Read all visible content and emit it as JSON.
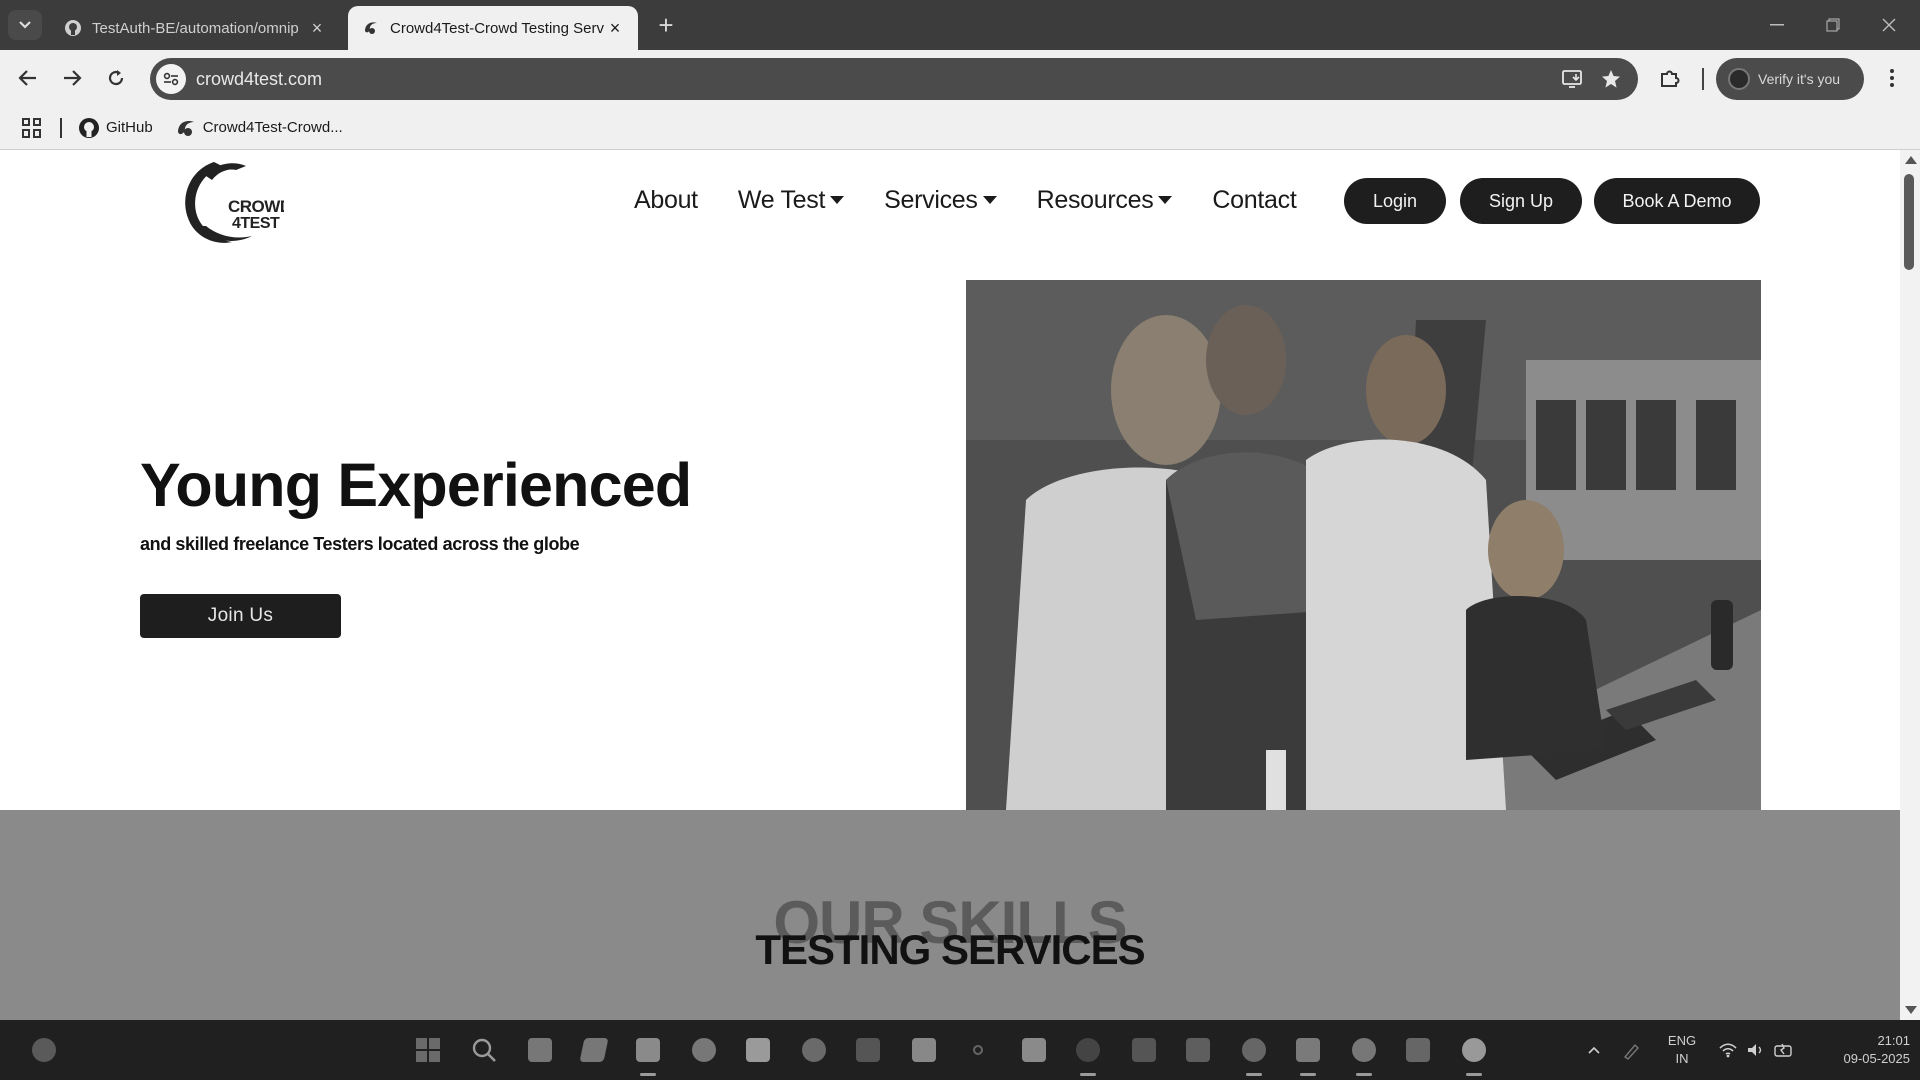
{
  "browser": {
    "tabs": [
      {
        "title": "TestAuth-BE/automation/omnip",
        "icon": "github-icon",
        "active": false
      },
      {
        "title": "Crowd4Test-Crowd Testing Serv",
        "icon": "crowd4test-favicon",
        "active": true
      }
    ],
    "url": "crowd4test.com",
    "verify_label": "Verify it's you",
    "bookmarks": [
      {
        "label": "GitHub",
        "icon": "github-icon"
      },
      {
        "label": "Crowd4Test-Crowd...",
        "icon": "crowd4test-favicon"
      }
    ]
  },
  "site": {
    "logo_text_line1": "CROWD",
    "logo_text_line2": "4TEST",
    "nav": [
      {
        "label": "About",
        "has_dropdown": false
      },
      {
        "label": "We Test",
        "has_dropdown": true
      },
      {
        "label": "Services",
        "has_dropdown": true
      },
      {
        "label": "Resources",
        "has_dropdown": true
      },
      {
        "label": "Contact",
        "has_dropdown": false
      }
    ],
    "buttons": {
      "login": "Login",
      "signup": "Sign Up",
      "demo": "Book A Demo"
    },
    "hero": {
      "title": "Young Experienced",
      "subtitle": "and skilled freelance Testers located across the globe",
      "cta": "Join Us"
    },
    "skills": {
      "background_heading": "OUR SKILLS",
      "heading": "TESTING SERVICES"
    }
  },
  "taskbar": {
    "language_line1": "ENG",
    "language_line2": "IN",
    "time": "21:01",
    "date": "09-05-2025"
  },
  "colors": {
    "chrome_dark": "#3c3c3c",
    "page_bg": "#ffffff",
    "pill_dark": "#1e1e1e",
    "skills_band": "#8a8a8a",
    "taskbar": "#202020"
  }
}
